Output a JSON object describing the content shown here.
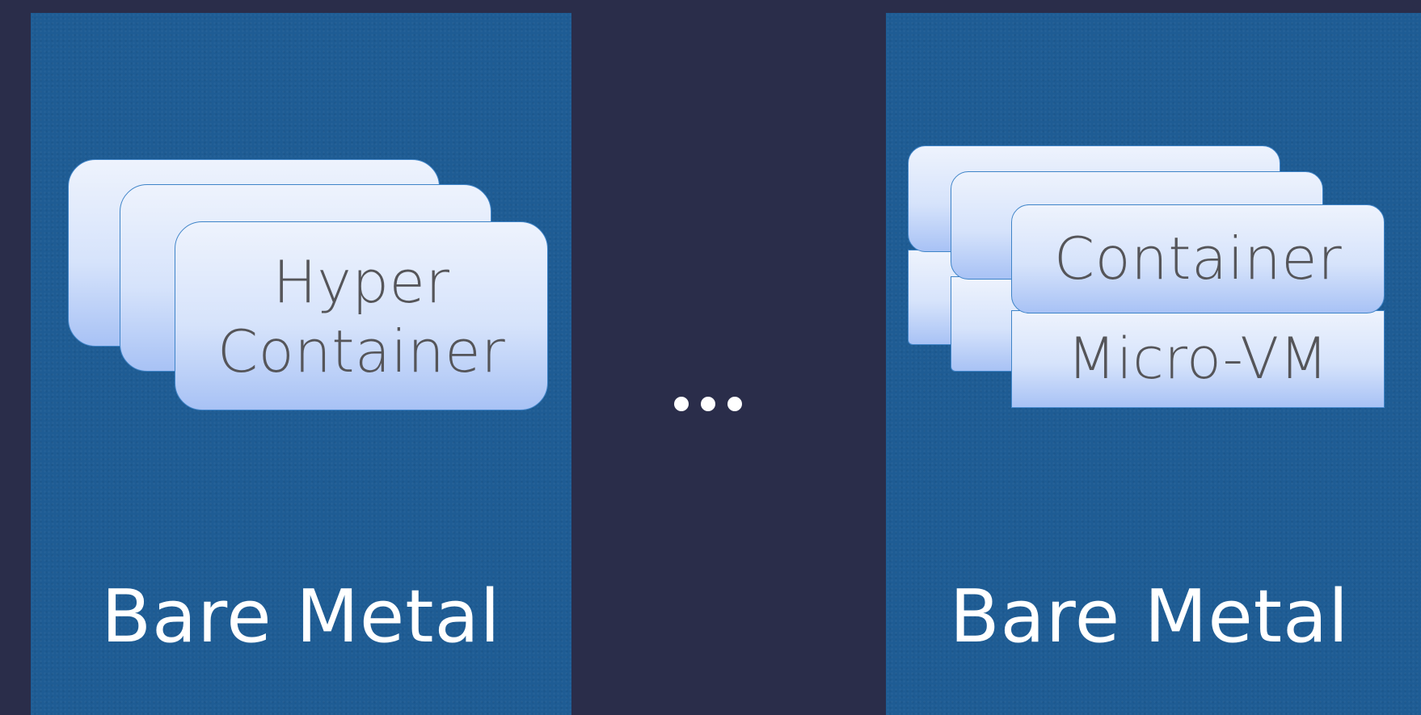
{
  "left_panel": {
    "card_label_line1": "Hyper",
    "card_label_line2": "Container",
    "base_label": "Bare Metal"
  },
  "right_panel": {
    "container_label": "Container",
    "vm_label": "Micro-VM",
    "base_label": "Bare Metal"
  },
  "separator": {
    "symbol": "ellipsis-dots"
  },
  "colors": {
    "background": "#2a2d4a",
    "panel": "#1e5c94",
    "card_border": "#3f84c8",
    "card_text": "#555559"
  }
}
